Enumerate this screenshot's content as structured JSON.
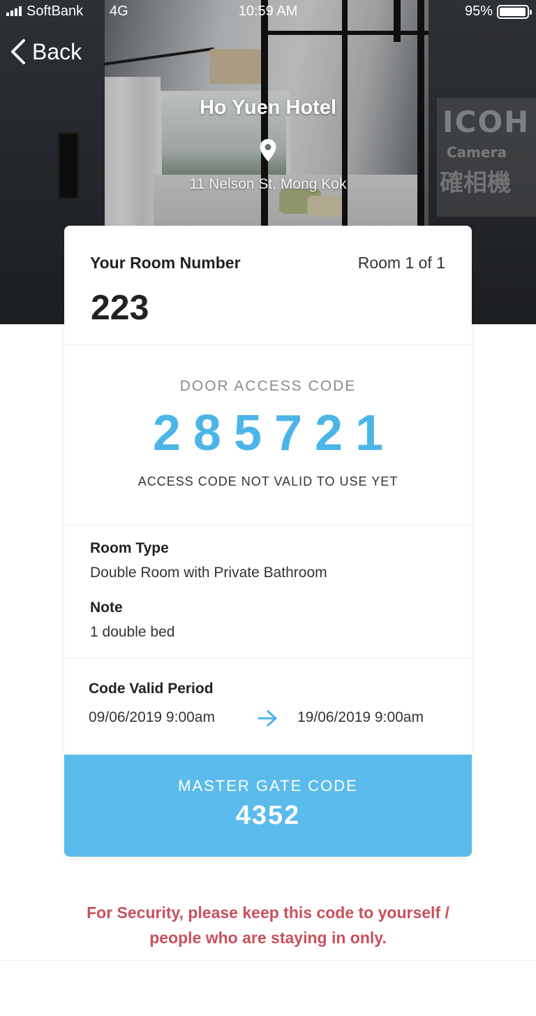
{
  "status_bar": {
    "carrier": "SoftBank",
    "network": "4G",
    "time": "10:59 AM",
    "battery": "95%"
  },
  "nav": {
    "back_label": "Back"
  },
  "hotel": {
    "name": "Ho Yuen Hotel",
    "address": "11 Nelson St, Mong Kok",
    "photo_sign": "ICOH",
    "photo_sign_sub": "Camera",
    "photo_sign_cjk": "確相機"
  },
  "room": {
    "label": "Your Room Number",
    "count": "Room 1 of 1",
    "number": "223"
  },
  "door": {
    "label": "DOOR ACCESS CODE",
    "code": "285721",
    "note": "ACCESS CODE NOT VALID TO USE YET"
  },
  "details": {
    "room_type_label": "Room Type",
    "room_type_value": "Double Room with Private Bathroom",
    "note_label": "Note",
    "note_value": "1 double bed"
  },
  "period": {
    "label": "Code Valid Period",
    "from": "09/06/2019 9:00am",
    "to": "19/06/2019 9:00am"
  },
  "gate": {
    "label": "MASTER GATE CODE",
    "code": "4352"
  },
  "security_notice": {
    "line1": "For Security, please keep this code to yourself /",
    "line2": "people who are staying in only."
  },
  "colors": {
    "accent": "#4cb5e8",
    "gate_bg": "#5bbbec",
    "warning": "#c8505c"
  },
  "icons": {
    "back": "chevron-left-icon",
    "location": "map-pin-icon",
    "arrow": "arrow-right-icon",
    "signal": "signal-bars-icon",
    "battery": "battery-icon"
  }
}
